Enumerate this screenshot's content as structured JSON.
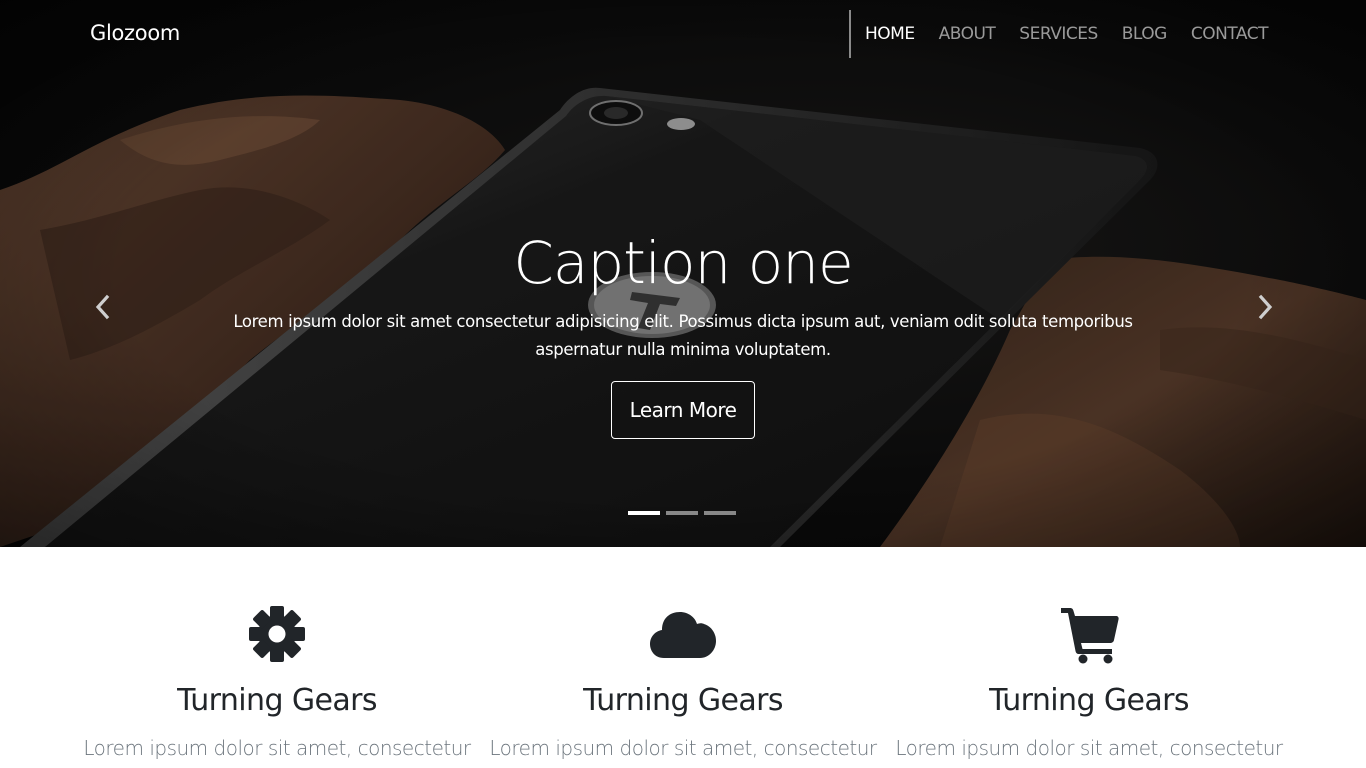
{
  "navbar": {
    "brand": "Glozoom",
    "links": [
      {
        "label": "HOME",
        "active": true
      },
      {
        "label": "ABOUT",
        "active": false
      },
      {
        "label": "SERVICES",
        "active": false
      },
      {
        "label": "BLOG",
        "active": false
      },
      {
        "label": "CONTACT",
        "active": false
      }
    ]
  },
  "carousel": {
    "caption_title": "Caption one",
    "caption_text": "Lorem ipsum dolor sit amet consectetur adipisicing elit. Possimus dicta ipsum aut, veniam odit soluta temporibus aspernatur nulla minima voluptatem.",
    "button_label": "Learn More",
    "prev_icon": "chevron-left-icon",
    "next_icon": "chevron-right-icon",
    "slide_count": 3,
    "active_slide": 1
  },
  "features": [
    {
      "icon": "gear-icon",
      "title": "Turning Gears",
      "text": "Lorem ipsum dolor sit amet, consectetur"
    },
    {
      "icon": "cloud-icon",
      "title": "Turning Gears",
      "text": "Lorem ipsum dolor sit amet, consectetur"
    },
    {
      "icon": "shopping-cart-icon",
      "title": "Turning Gears",
      "text": "Lorem ipsum dolor sit amet, consectetur"
    }
  ],
  "colors": {
    "hero_background": "#0d0d0d",
    "nav_active": "#ffffff",
    "nav_inactive": "#9a9a9a",
    "icon": "#212529",
    "feature_title": "#212529",
    "feature_text": "#6c757d"
  }
}
